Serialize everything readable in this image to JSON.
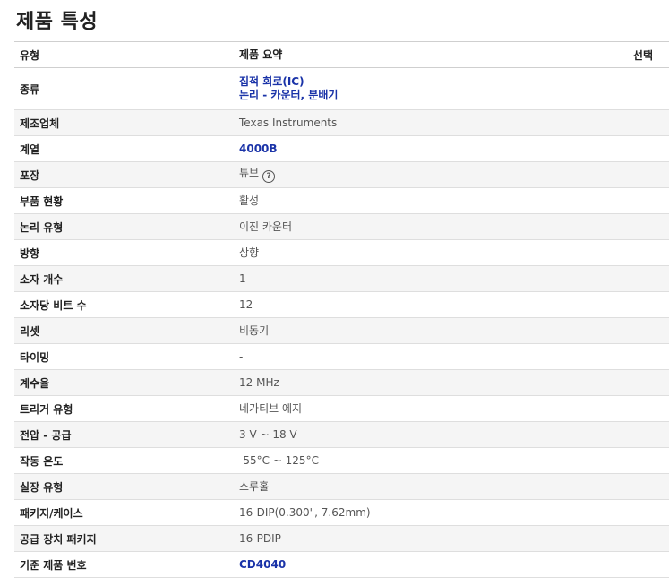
{
  "page_title": "제품 특성",
  "header": {
    "col_type": "유형",
    "col_summary": "제품 요약",
    "col_select": "선택"
  },
  "rows": [
    {
      "label": "종류",
      "values": [
        "집적 회로(IC)",
        "논리 - 카운터, 분배기"
      ],
      "link": true
    },
    {
      "label": "제조업체",
      "values": [
        "Texas Instruments"
      ],
      "link": false
    },
    {
      "label": "계열",
      "values": [
        "4000B"
      ],
      "link": true
    },
    {
      "label": "포장",
      "values": [
        "튜브"
      ],
      "link": false,
      "help_icon": true
    },
    {
      "label": "부품 현황",
      "values": [
        "활성"
      ],
      "link": false
    },
    {
      "label": "논리 유형",
      "values": [
        "이진 카운터"
      ],
      "link": false
    },
    {
      "label": "방향",
      "values": [
        "상향"
      ],
      "link": false
    },
    {
      "label": "소자 개수",
      "values": [
        "1"
      ],
      "link": false
    },
    {
      "label": "소자당 비트 수",
      "values": [
        "12"
      ],
      "link": false
    },
    {
      "label": "리셋",
      "values": [
        "비동기"
      ],
      "link": false
    },
    {
      "label": "타이밍",
      "values": [
        "-"
      ],
      "link": false
    },
    {
      "label": "계수율",
      "values": [
        "12 MHz"
      ],
      "link": false
    },
    {
      "label": "트리거 유형",
      "values": [
        "네가티브 에지"
      ],
      "link": false
    },
    {
      "label": "전압 - 공급",
      "values": [
        "3 V ~ 18 V"
      ],
      "link": false
    },
    {
      "label": "작동 온도",
      "values": [
        "-55°C ~ 125°C"
      ],
      "link": false
    },
    {
      "label": "실장 유형",
      "values": [
        "스루홀"
      ],
      "link": false
    },
    {
      "label": "패키지/케이스",
      "values": [
        "16-DIP(0.300\", 7.62mm)"
      ],
      "link": false
    },
    {
      "label": "공급 장치 패키지",
      "values": [
        "16-PDIP"
      ],
      "link": false
    },
    {
      "label": "기준 제품 번호",
      "values": [
        "CD4040"
      ],
      "link": true
    }
  ],
  "icons": {
    "help": "question-circle-icon"
  }
}
